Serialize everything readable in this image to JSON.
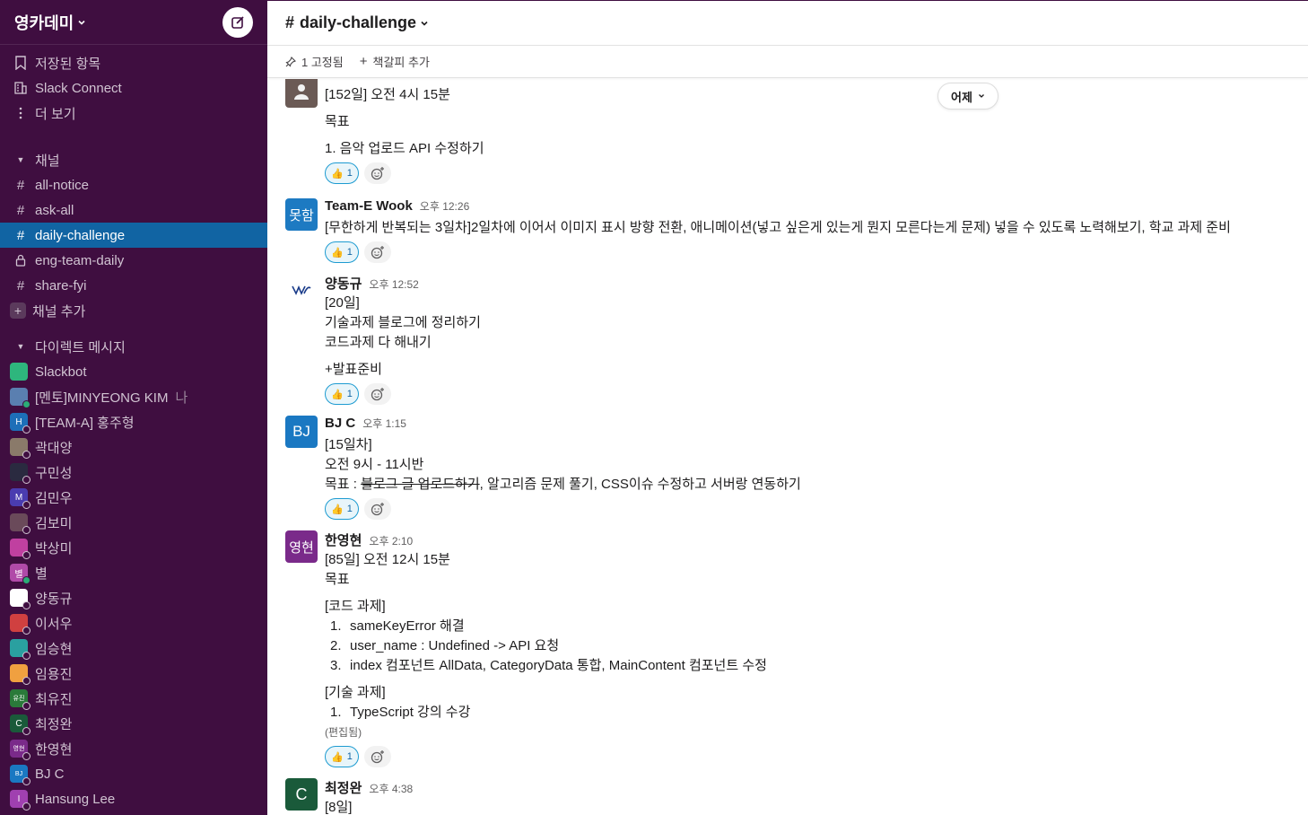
{
  "workspace": {
    "name": "영카데미"
  },
  "sidebar": {
    "top_items": [
      {
        "label": "저장된 항목",
        "icon": "bookmark-icon"
      },
      {
        "label": "Slack Connect",
        "icon": "building-icon"
      },
      {
        "label": "더 보기",
        "icon": "more-vertical-icon"
      }
    ],
    "channels_header": "채널",
    "channels": [
      {
        "label": "all-notice",
        "icon": "hash"
      },
      {
        "label": "ask-all",
        "icon": "hash"
      },
      {
        "label": "daily-challenge",
        "icon": "hash",
        "active": true
      },
      {
        "label": "eng-team-daily",
        "icon": "lock"
      },
      {
        "label": "share-fyi",
        "icon": "hash"
      }
    ],
    "add_channel": "채널 추가",
    "dm_header": "다이렉트 메시지",
    "dms": [
      {
        "label": "Slackbot",
        "avatar_color": "#2eb67d",
        "avatar_text": "",
        "status": "none"
      },
      {
        "label": "[멘토]MINYEONG KIM",
        "avatar_color": "#5a7fb0",
        "avatar_text": "",
        "status": "on",
        "suffix": "나"
      },
      {
        "label": "[TEAM-A] 홍주형",
        "avatar_color": "#1d6fb8",
        "avatar_text": "H",
        "status": "off"
      },
      {
        "label": "곽대양",
        "avatar_color": "#8a7a6a",
        "avatar_text": "",
        "status": "off"
      },
      {
        "label": "구민성",
        "avatar_color": "#2a2a40",
        "avatar_text": "",
        "status": "off"
      },
      {
        "label": "김민우",
        "avatar_color": "#4a3cb0",
        "avatar_text": "M",
        "status": "off"
      },
      {
        "label": "김보미",
        "avatar_color": "#6a4a5a",
        "avatar_text": "",
        "status": "off"
      },
      {
        "label": "박상미",
        "avatar_color": "#c040a0",
        "avatar_text": "",
        "status": "off"
      },
      {
        "label": "별",
        "avatar_color": "#b04aa8",
        "avatar_text": "별",
        "status": "on"
      },
      {
        "label": "양동규",
        "avatar_color": "#ffffff",
        "avatar_text": "",
        "status": "off"
      },
      {
        "label": "이서우",
        "avatar_color": "#d04040",
        "avatar_text": "",
        "status": "off"
      },
      {
        "label": "임승현",
        "avatar_color": "#2aa0a0",
        "avatar_text": "",
        "status": "off"
      },
      {
        "label": "임용진",
        "avatar_color": "#f0a040",
        "avatar_text": "",
        "status": "off"
      },
      {
        "label": "최유진",
        "avatar_color": "#2a7a3a",
        "avatar_text": "유진",
        "status": "off"
      },
      {
        "label": "최정완",
        "avatar_color": "#1a5a3a",
        "avatar_text": "C",
        "status": "off"
      },
      {
        "label": "한영현",
        "avatar_color": "#7a2a8a",
        "avatar_text": "영현",
        "status": "off"
      },
      {
        "label": "BJ C",
        "avatar_color": "#1a78c2",
        "avatar_text": "BJ",
        "status": "off"
      },
      {
        "label": "Hansung Lee",
        "avatar_color": "#a040b0",
        "avatar_text": "I",
        "status": "off"
      }
    ]
  },
  "channel": {
    "name": "daily-challenge",
    "pinned": "1 고정됨",
    "add_bookmark": "책갈피 추가"
  },
  "date_divider": "어제",
  "messages": [
    {
      "lines": [
        "[152일] 오전 4시 15분",
        "",
        "목표",
        "",
        "1. 음악 업로드 API 수정하기"
      ],
      "reaction_count": "1"
    },
    {
      "name": "Team-E Wook",
      "time": "오후 12:26",
      "avatar_text": "못함",
      "avatar_color": "#1d7ac2",
      "lines": [
        "[무한하게 반복되는 3일차]2일차에 이어서 이미지 표시 방향 전환, 애니메이션(넣고 싶은게 있는게 뭔지 모른다는게 문제) 넣을 수 있도록 노력해보기, 학교 과제 준비"
      ],
      "reaction_count": "1"
    },
    {
      "name": "양동규",
      "time": "오후 12:52",
      "lines": [
        "[20일]",
        "기술과제 블로그에 정리하기",
        "코드과제 다 해내기",
        "",
        "+발표준비"
      ],
      "reaction_count": "1"
    },
    {
      "name": "BJ C",
      "time": "오후 1:15",
      "avatar_text": "BJ",
      "avatar_color": "#1a78c2",
      "lines": [
        "[15일차]",
        "오전 9시 - 11시반"
      ],
      "goal_prefix": "목표 : ",
      "goal_struck": "블로그 글 업로드하기",
      "goal_rest": ", 알고리즘 문제 풀기, CSS이슈 수정하고 서버랑 연동하기",
      "reaction_count": "1"
    },
    {
      "name": "한영현",
      "time": "오후 2:10",
      "avatar_text": "영현",
      "avatar_color": "#7a2a8a",
      "lines": [
        "[85일] 오전 12시 15분",
        "목표"
      ],
      "code_header": "[코드 과제]",
      "code_items": [
        "sameKeyError 해결",
        "user_name : Undefined -> API 요청",
        "index 컴포넌트 AllData, CategoryData 통합, MainContent 컴포넌트 수정"
      ],
      "tech_header": "[기술 과제]",
      "tech_items": [
        "TypeScript 강의 수강"
      ],
      "edited": "(편집됨)",
      "reaction_count": "1"
    },
    {
      "name": "최정완",
      "time": "오후 4:38",
      "avatar_text": "C",
      "avatar_color": "#1a5a3a",
      "lines": [
        "[8일]"
      ]
    }
  ]
}
